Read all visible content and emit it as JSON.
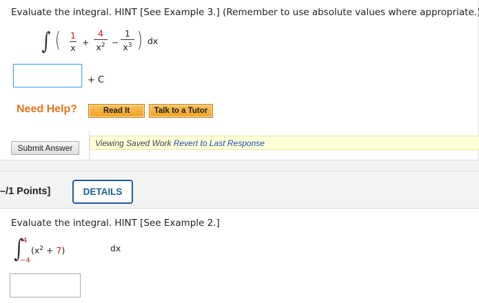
{
  "q1": {
    "prompt": "Evaluate the integral. HINT [See Example 3.] (Remember to use absolute values where appropriate.)",
    "integrand": {
      "t1_num": "1",
      "t1_den": "x",
      "op1": "+",
      "t2_num": "4",
      "t2_den_base": "x",
      "t2_den_exp": "2",
      "op2": "−",
      "t3_num": "1",
      "t3_den_base": "x",
      "t3_den_exp": "3",
      "dx": "dx"
    },
    "answer_value": "",
    "plus_c": "+ C",
    "need_help": "Need Help?",
    "read_it": "Read It",
    "talk_to_tutor": "Talk to a Tutor",
    "submit_label": "Submit Answer",
    "saved_text": "Viewing Saved Work ",
    "revert_link": "Revert to Last Response"
  },
  "q2": {
    "points": "–/1 Points]",
    "details_label": "DETAILS",
    "prompt": "Evaluate the integral. HINT [See Example 2.]",
    "integral": {
      "upper": "4",
      "lower": "−4",
      "open": "(x",
      "exp": "2",
      "plus": " + ",
      "const": "7",
      "close": ")",
      "dx": "dx"
    },
    "answer_value": ""
  },
  "colors": {
    "accent_red": "#d8120f",
    "need_help_orange": "#e8741c",
    "details_blue": "#1a5c99",
    "link_blue": "#1b4dbf"
  }
}
